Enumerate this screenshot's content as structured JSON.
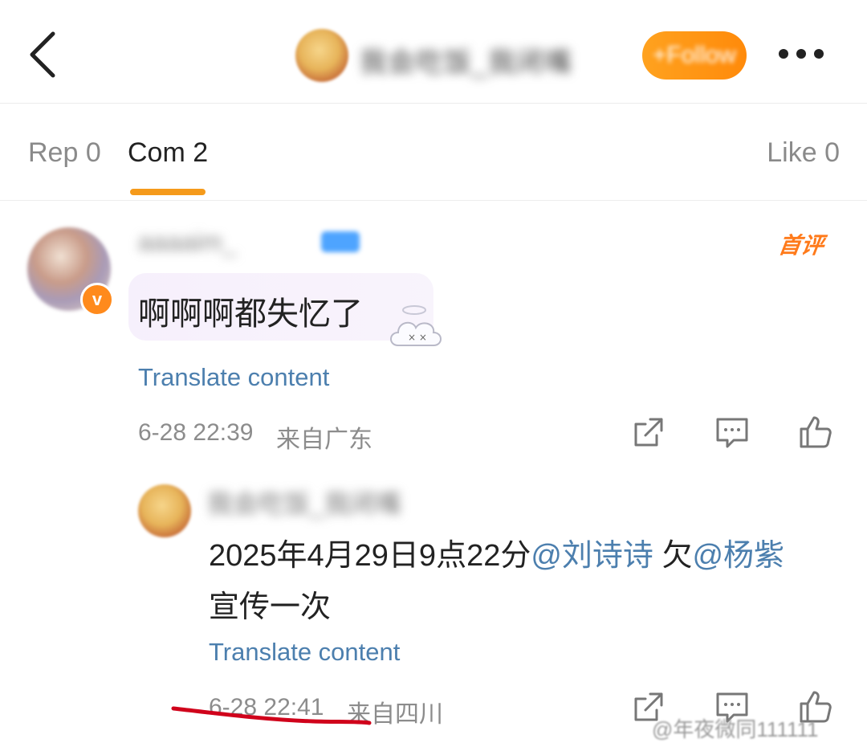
{
  "header": {
    "back_icon": "chevron-left-icon",
    "user_name": "我会吃饭_我闭嘴",
    "follow_label": "+Follow",
    "more_icon": "more-horizontal-icon",
    "accent_color": "#ff8a0a"
  },
  "tabs": [
    {
      "label": "Rep 0",
      "active": false
    },
    {
      "label": "Com 2",
      "active": true
    },
    {
      "label": "Like 0",
      "active": false
    }
  ],
  "comments": [
    {
      "user_name": "aaaaim_",
      "verified_badge": "v",
      "first_badge": "首评",
      "text": "啊啊啊都失忆了",
      "translate_label": "Translate content",
      "time": "6-28 22:39",
      "location": "来自广东",
      "actions": [
        "share-icon",
        "comment-icon",
        "like-icon"
      ]
    }
  ],
  "reply": {
    "user_name": "我会吃饭_我闭嘴",
    "text_prefix": "2025年4月29日9点22分",
    "mention_1": "@刘诗诗",
    "text_mid": " 欠",
    "mention_2": "@杨紫",
    "text_suffix": "宣传一次",
    "translate_label": "Translate content",
    "time": "6-28 22:41",
    "location": "来自四川",
    "actions": [
      "share-icon",
      "comment-icon",
      "like-icon"
    ]
  },
  "watermark": "@年夜微同111111",
  "annotation_color": "#d0021b"
}
